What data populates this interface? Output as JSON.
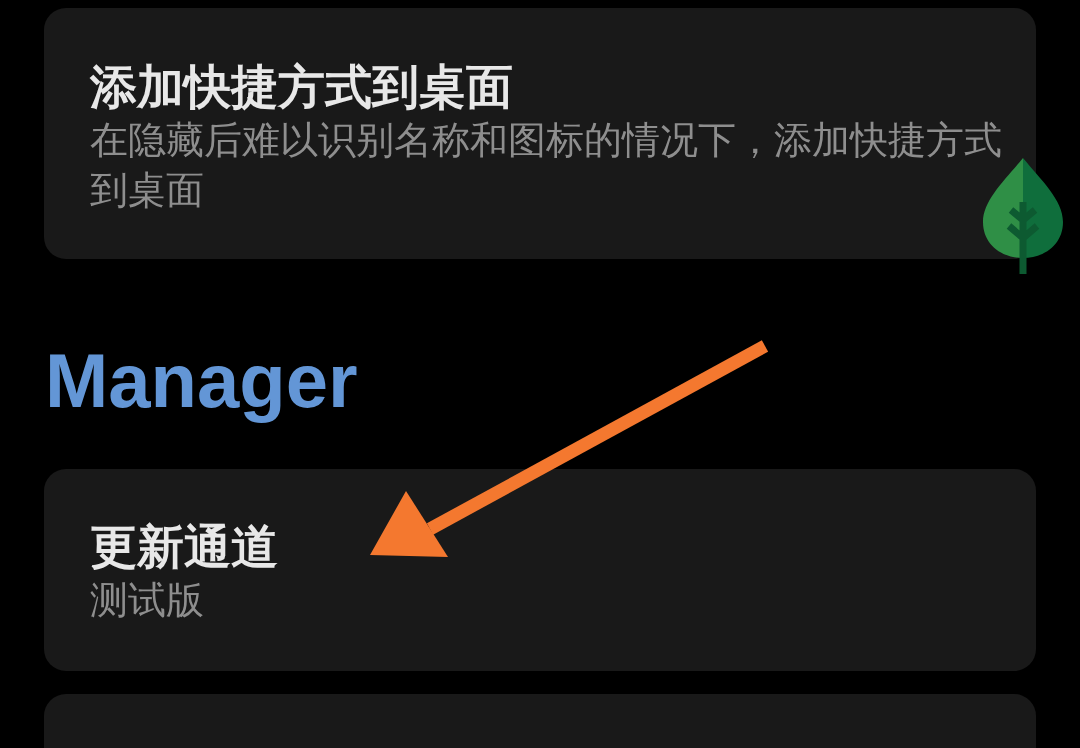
{
  "top_items": [
    {
      "kind": "setting",
      "title": "添加快捷方式到桌面",
      "subtitle": "在隐藏后难以识别名称和图标的情况下，添加快捷方式到桌面"
    }
  ],
  "section": {
    "heading": "Manager",
    "items": [
      {
        "kind": "setting",
        "title": "更新通道",
        "subtitle": "测试版"
      },
      {
        "kind": "setting"
      }
    ]
  }
}
